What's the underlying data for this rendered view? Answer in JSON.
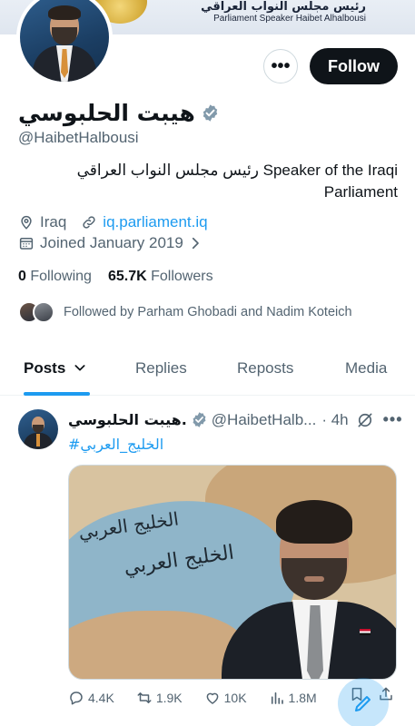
{
  "banner": {
    "arabic_title": "رئيس مجلس النواب العراقي",
    "english_title": "Parliament Speaker Haibet Alhalbousi"
  },
  "profile": {
    "display_name": "هيبت الحلبوسي",
    "handle": "@HaibetHalbousi",
    "bio": "رئيس مجلس النواب العراقي Speaker of the Iraqi Parliament",
    "location": "Iraq",
    "website": "iq.parliament.iq",
    "joined": "Joined January 2019",
    "following_count": "0",
    "following_label": "Following",
    "followers_count": "65.7K",
    "followers_label": "Followers",
    "followed_by": "Followed by Parham Ghobadi and Nadim Koteich"
  },
  "buttons": {
    "more": "•••",
    "follow": "Follow"
  },
  "tabs": [
    {
      "label": "Posts",
      "active": true
    },
    {
      "label": "Replies",
      "active": false
    },
    {
      "label": "Reposts",
      "active": false
    },
    {
      "label": "Media",
      "active": false
    }
  ],
  "post": {
    "author_name": "هيبت الحلبوسي.",
    "author_handle": "@HaibetHalb...",
    "time": "· 4h",
    "hashtag": "#الخليج_العربي",
    "image_text_1": "الخليج العربي",
    "image_text_2": "الخليج العربي",
    "replies": "4.4K",
    "reposts": "1.9K",
    "likes": "10K",
    "views": "1.8M"
  },
  "icons": {
    "verified": "verified-badge-icon",
    "location": "location-pin-icon",
    "link": "link-icon",
    "calendar": "calendar-icon",
    "chevron": "chevron-right-icon",
    "dropdown": "chevron-down-icon",
    "grok": "grok-icon",
    "reply": "reply-icon",
    "repost": "repost-icon",
    "like": "heart-icon",
    "views": "views-icon",
    "bookmark": "bookmark-icon",
    "share": "share-icon",
    "compose": "compose-icon"
  },
  "colors": {
    "accent": "#1d9bf0",
    "text": "#0f1419",
    "muted": "#536471",
    "verified": "#829aab"
  }
}
